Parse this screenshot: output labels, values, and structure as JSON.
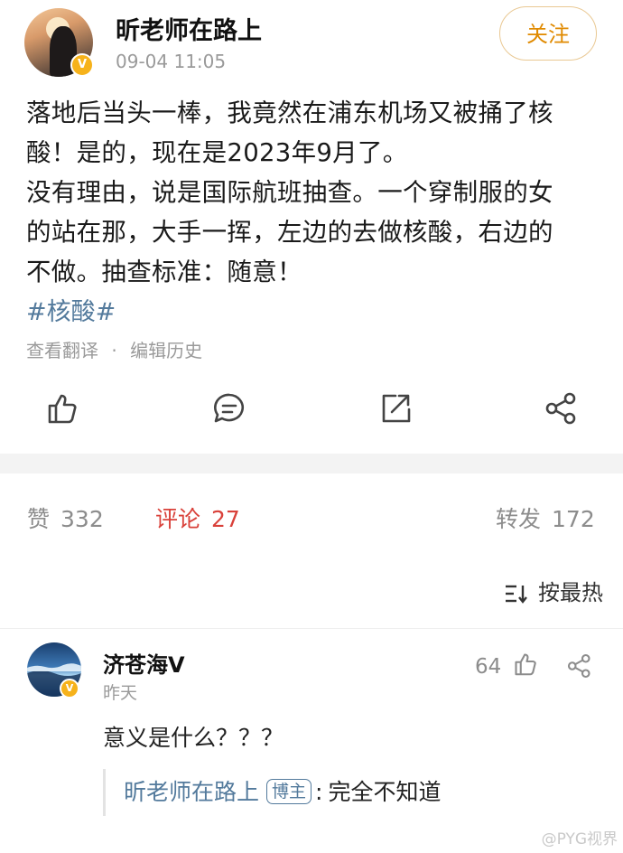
{
  "post": {
    "author": "昕老师在路上",
    "verified_badge": "V",
    "timestamp": "09-04 11:05",
    "follow_label": "关注",
    "text_lines": [
      "落地后当头一棒，我竟然在浦东机场又被捅了核",
      "酸！是的，现在是2023年9月了。",
      "没有理由，说是国际航班抽查。一个穿制服的女",
      "的站在那，大手一挥，左边的去做核酸，右边的",
      "不做。抽查标准：随意！"
    ],
    "hashtag": "#核酸#",
    "translate_label": "查看翻译",
    "meta_separator": "·",
    "edit_history_label": "编辑历史",
    "actions": [
      "like-icon",
      "comment-icon",
      "repost-icon",
      "share-icon"
    ]
  },
  "stats": {
    "likes_label": "赞",
    "likes_count": "332",
    "comments_label": "评论",
    "comments_count": "27",
    "reposts_label": "转发",
    "reposts_count": "172",
    "sort_label": "按最热"
  },
  "comment": {
    "author": "济苍海V",
    "verified_badge": "V",
    "time": "昨天",
    "likes": "64",
    "text": "意义是什么？？？",
    "reply": {
      "author": "昕老师在路上",
      "tag": "博主",
      "colon": ":",
      "text": "完全不知道"
    }
  },
  "watermark": "@PYG视界",
  "colors": {
    "accent_red": "#d9413a",
    "link_blue": "#537a9c",
    "follow_orange": "#e08a00",
    "badge_gold": "#f6b21b"
  }
}
